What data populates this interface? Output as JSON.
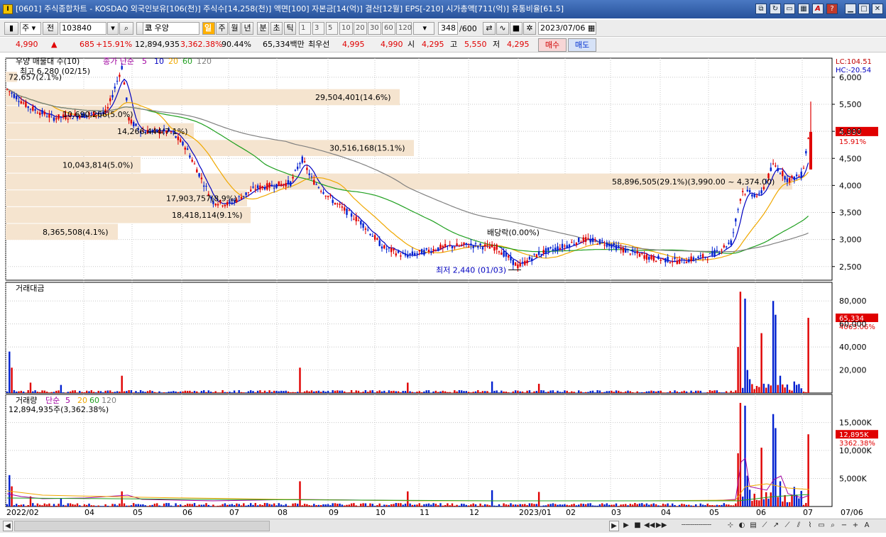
{
  "window": {
    "title": "[0601] 주식종합차트 - KOSDAQ 외국인보유[106(천)] 주식수[14,258(천)] 액면[100] 자본금[14(억)] 결산[12월] EPS[-210] 시가총액[711(억)] 유통비율[61.5]",
    "app_icon": "I"
  },
  "toolbar": {
    "market_select": "주",
    "prev_label": "전",
    "code": "103840",
    "market_type": "코",
    "stock_name": "우양",
    "periods": [
      "일",
      "주",
      "월",
      "년",
      "분",
      "초",
      "틱"
    ],
    "intervals": [
      "1",
      "3",
      "5",
      "10",
      "20",
      "30",
      "60",
      "120"
    ],
    "count": "348",
    "total": "/600",
    "date": "2023/07/06"
  },
  "quote": {
    "price": "4,990",
    "change_arrow": "▲",
    "change": "685",
    "change_pct": "+15.91%",
    "volume": "12,894,935",
    "volume_ratio": "3,362.38%",
    "rate": "90.44%",
    "amount": "65,334백만",
    "best_label": "최우선",
    "ask": "4,995",
    "bid": "4,990",
    "open_label": "시",
    "open": "4,295",
    "high_label": "고",
    "high": "5,550",
    "low_label": "저",
    "low": "4,295",
    "buy_label": "매수",
    "sell_label": "매도"
  },
  "price_panel": {
    "legend_vp": "우양 매물대 수(10)",
    "legend_ma": "종가 단순",
    "legend_periods": [
      "5",
      "10",
      "20",
      "60",
      "120"
    ],
    "high_note": "최고 6,280 (02/15)",
    "low_note": "최저 2,440 (01/03)",
    "vp_labels": [
      "72,657(2.1%)",
      "29,504,401(14.6%)",
      "10,690,266(5.0%)",
      "14,266,444(7.1%)",
      "30,516,168(15.1%)",
      "10,043,814(5.0%)",
      "58,896,505(29.1%)(3,990.00 ~ 4,374.00)",
      "17,903,757(8.9%)",
      "18,418,114(9.1%)",
      "8,365,508(4.1%)"
    ],
    "event_label": "배당락(0.00%)",
    "lc": "LC:104.51",
    "hc": "HC:-20.54",
    "current_price": "4,990",
    "current_pct": "15.91%",
    "y_ticks": [
      "6,000",
      "5,500",
      "5,000",
      "4,500",
      "4,000",
      "3,500",
      "3,000",
      "2,500"
    ]
  },
  "amount_panel": {
    "title": "거래대금",
    "current": "65,334",
    "current_pct": "4063.06%",
    "y_ticks": [
      "80,000",
      "60,000",
      "40,000",
      "20,000"
    ]
  },
  "volume_panel": {
    "title": "거래량",
    "ma_label": "단순",
    "ma_periods": [
      "5",
      "20",
      "60",
      "120"
    ],
    "value_line": "12,894,935주(3,362.38%)",
    "current": "12,895K",
    "current_pct": "3362.38%",
    "y_ticks": [
      "15,000K",
      "10,000K",
      "5,000K"
    ]
  },
  "x_axis": [
    "2022/02",
    "04",
    "05",
    "06",
    "07",
    "08",
    "09",
    "10",
    "11",
    "12",
    "2023/01",
    "02",
    "03",
    "04",
    "05",
    "06",
    "07",
    "07/06"
  ],
  "colors": {
    "up": "#e00000",
    "down": "#0020d0",
    "ma5": "#0000c0",
    "ma20": "#f0a800",
    "ma60": "#20a020",
    "ma120": "#808080",
    "vp_band": "#f5e4cf"
  },
  "chart_data": {
    "type": "candlestick",
    "title": "우양 (103840) 일봉",
    "price_range": [
      2300,
      6300
    ],
    "months": [
      "2022/02",
      "04",
      "05",
      "06",
      "07",
      "08",
      "09",
      "10",
      "11",
      "12",
      "2023/01",
      "02",
      "03",
      "04",
      "05",
      "06",
      "07"
    ],
    "approx_close_path": [
      {
        "x": "2022/02",
        "y": 5800
      },
      {
        "x": "03",
        "y": 5300
      },
      {
        "x": "04",
        "y": 5200
      },
      {
        "x": "04/15",
        "y": 6280
      },
      {
        "x": "05",
        "y": 4900
      },
      {
        "x": "06",
        "y": 4700
      },
      {
        "x": "06/20",
        "y": 3500
      },
      {
        "x": "07",
        "y": 3700
      },
      {
        "x": "08",
        "y": 4000
      },
      {
        "x": "08/15",
        "y": 4750
      },
      {
        "x": "09",
        "y": 3700
      },
      {
        "x": "10",
        "y": 3100
      },
      {
        "x": "10/20",
        "y": 2600
      },
      {
        "x": "11",
        "y": 2800
      },
      {
        "x": "12",
        "y": 2900
      },
      {
        "x": "2023/01/03",
        "y": 2440
      },
      {
        "x": "02",
        "y": 3000
      },
      {
        "x": "03",
        "y": 2800
      },
      {
        "x": "04",
        "y": 2600
      },
      {
        "x": "05",
        "y": 2800
      },
      {
        "x": "05/20",
        "y": 3800
      },
      {
        "x": "06",
        "y": 4400
      },
      {
        "x": "07/06",
        "y": 4990
      }
    ],
    "last": {
      "open": 4295,
      "high": 5550,
      "low": 4295,
      "close": 4990,
      "volume": 12894935,
      "amount_mil": 65334
    }
  }
}
